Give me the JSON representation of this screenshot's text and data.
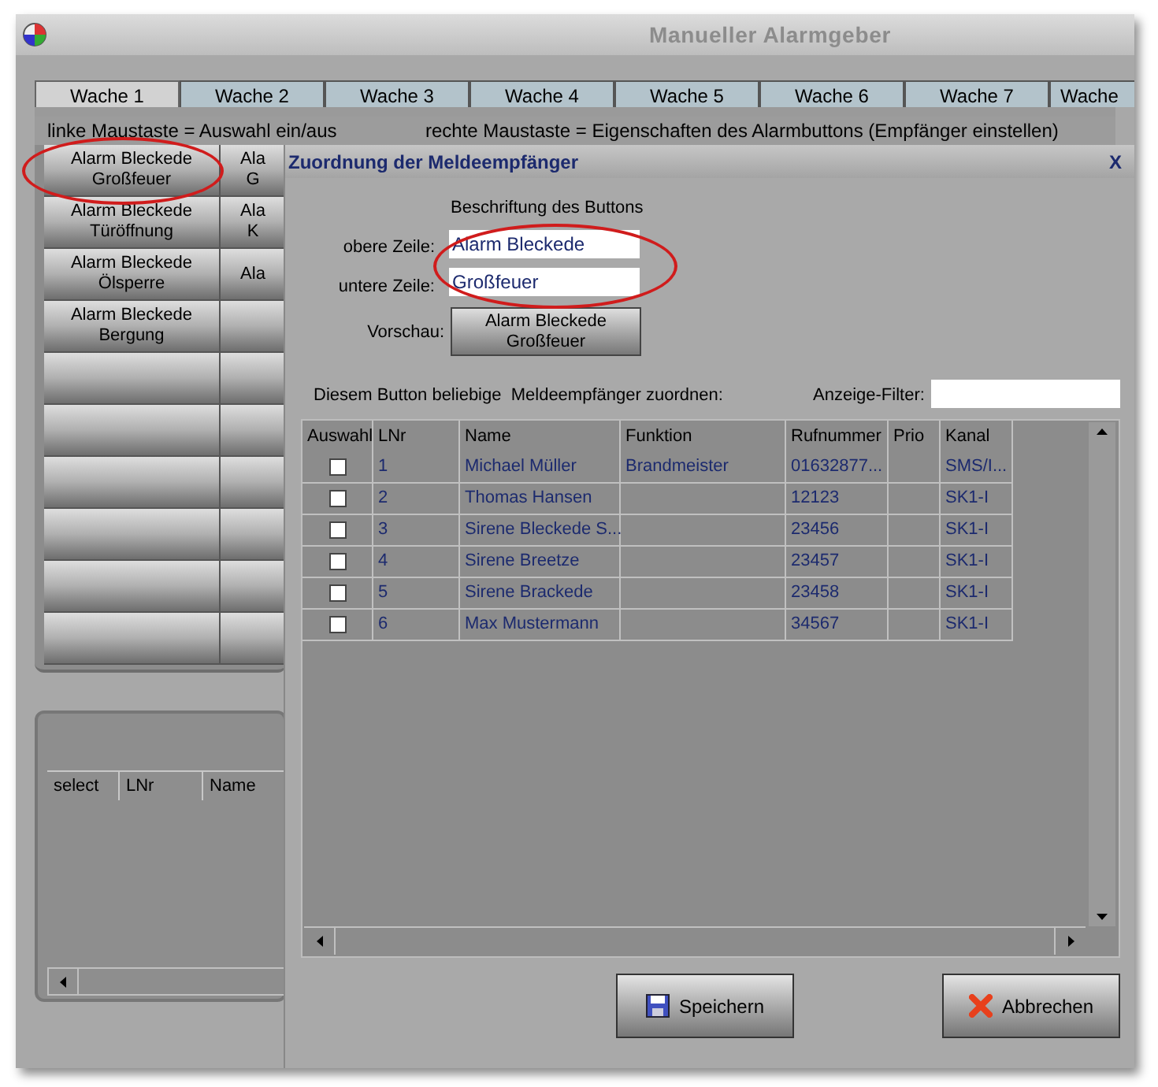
{
  "window": {
    "title": "Manueller Alarmgeber"
  },
  "tabs": [
    {
      "label": "Wache 1",
      "selected": true
    },
    {
      "label": "Wache 2",
      "selected": false
    },
    {
      "label": "Wache 3",
      "selected": false
    },
    {
      "label": "Wache 4",
      "selected": false
    },
    {
      "label": "Wache 5",
      "selected": false
    },
    {
      "label": "Wache 6",
      "selected": false
    },
    {
      "label": "Wache 7",
      "selected": false
    },
    {
      "label": "Wache",
      "selected": false
    }
  ],
  "hints": [
    "linke Maustaste = Auswahl ein/aus",
    "rechte Maustaste = Eigenschaften des Alarmbuttons (Empfänger einstellen)"
  ],
  "alarm_buttons": [
    {
      "kind": "labeled",
      "lines": [
        "Alarm Bleckede",
        "Großfeuer"
      ]
    },
    {
      "kind": "labeled",
      "lines": [
        "Ala",
        "G"
      ]
    },
    {
      "kind": "labeled",
      "lines": [
        "Alarm Bleckede",
        "Türöffnung"
      ]
    },
    {
      "kind": "labeled",
      "lines": [
        "Ala",
        "K"
      ]
    },
    {
      "kind": "labeled",
      "lines": [
        "Alarm Bleckede",
        "Ölsperre"
      ]
    },
    {
      "kind": "labeled",
      "lines": [
        "Ala"
      ]
    },
    {
      "kind": "labeled",
      "lines": [
        "Alarm Bleckede",
        "Bergung"
      ]
    },
    {
      "kind": "blank"
    },
    {
      "kind": "blank"
    },
    {
      "kind": "blank"
    },
    {
      "kind": "blank"
    },
    {
      "kind": "blank"
    },
    {
      "kind": "blank"
    },
    {
      "kind": "blank"
    },
    {
      "kind": "blank"
    },
    {
      "kind": "blank"
    },
    {
      "kind": "blank"
    },
    {
      "kind": "blank"
    },
    {
      "kind": "blank"
    },
    {
      "kind": "blank"
    }
  ],
  "selection_list": {
    "columns": [
      "select",
      "LNr",
      "Name"
    ]
  },
  "dialog": {
    "title": "Zuordnung der Meldeempfänger",
    "close": "X",
    "caption_heading": "Beschriftung des Buttons",
    "upper_label": "obere Zeile:",
    "upper_value": "Alarm Bleckede",
    "lower_label": "untere Zeile:",
    "lower_value": "Großfeuer",
    "preview_label": "Vorschau:",
    "preview_lines": [
      "Alarm Bleckede",
      "Großfeuer"
    ],
    "assign_text": "Diesem Button beliebige  Meldeempfänger zuordnen:",
    "filter_label": "Anzeige-Filter:",
    "table": {
      "select_column": "Auswahl",
      "columns": [
        "LNr",
        "Name",
        "Funktion",
        "Rufnummer",
        "Prio",
        "Kanal"
      ],
      "rows": [
        {
          "checked": false,
          "cells": [
            "1",
            "Michael Müller",
            "Brandmeister",
            "01632877...",
            null,
            "SMS/I..."
          ]
        },
        {
          "checked": false,
          "cells": [
            "2",
            "Thomas Hansen",
            null,
            "12123",
            null,
            "SK1-I"
          ]
        },
        {
          "checked": false,
          "cells": [
            "3",
            "Sirene Bleckede S...",
            null,
            "23456",
            null,
            "SK1-I"
          ]
        },
        {
          "checked": false,
          "cells": [
            "4",
            "Sirene Breetze",
            null,
            "23457",
            null,
            "SK1-I"
          ]
        },
        {
          "checked": false,
          "cells": [
            "5",
            "Sirene Brackede",
            null,
            "23458",
            null,
            "SK1-I"
          ]
        },
        {
          "checked": false,
          "cells": [
            "6",
            "Max Mustermann",
            null,
            "34567",
            null,
            "SK1-I"
          ]
        }
      ]
    },
    "buttons": [
      {
        "kind": "save",
        "label": "Speichern"
      },
      {
        "kind": "cancel",
        "label": "Abbrechen"
      }
    ]
  }
}
